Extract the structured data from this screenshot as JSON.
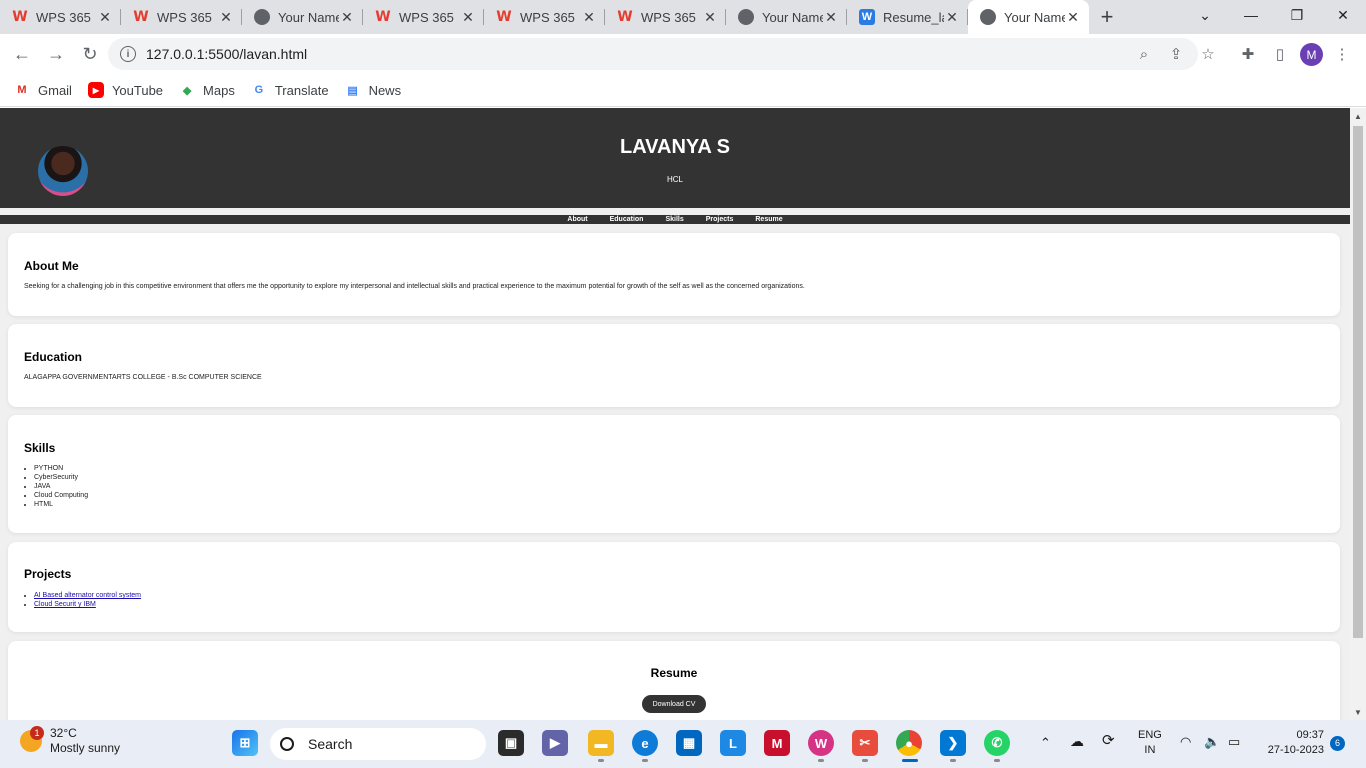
{
  "browser": {
    "tabs": [
      {
        "title": "WPS 365",
        "icon": "wps-icon"
      },
      {
        "title": "WPS 365",
        "icon": "wps-icon"
      },
      {
        "title": "Your Name",
        "icon": "globe-icon"
      },
      {
        "title": "WPS 365",
        "icon": "wps-icon"
      },
      {
        "title": "WPS 365",
        "icon": "wps-icon"
      },
      {
        "title": "WPS 365",
        "icon": "wps-icon"
      },
      {
        "title": "Your Name",
        "icon": "globe-icon"
      },
      {
        "title": "Resume_la",
        "icon": "wps-doc-icon"
      },
      {
        "title": "Your Name",
        "icon": "globe-icon",
        "active": true
      }
    ],
    "url": "127.0.0.1:5500/lavan.html",
    "profile_initial": "M",
    "bookmarks": [
      "Gmail",
      "YouTube",
      "Maps",
      "Translate",
      "News"
    ]
  },
  "site": {
    "name": "LAVANYA S",
    "subtitle": "HCL",
    "nav": [
      "About",
      "Education",
      "Skills",
      "Projects",
      "Resume"
    ],
    "about": {
      "heading": "About Me",
      "text": "Seeking for a challenging job in this competitive environment that offers me the opportunity to explore my interpersonal and intellectual skills and practical experience to the maximum potential for growth of the self as well as the concerned organizations."
    },
    "education": {
      "heading": "Education",
      "text": "ALAGAPPA GOVERNMENTARTS COLLEGE - B.Sc COMPUTER SCIENCE"
    },
    "skills": {
      "heading": "Skills",
      "items": [
        "PYTHON",
        "CyberSecurity",
        "JAVA",
        "Cloud Computing",
        "HTML"
      ]
    },
    "projects": {
      "heading": "Projects",
      "items": [
        "AI Based alternator control system",
        "Cloud Securit y IBM"
      ]
    },
    "resume": {
      "heading": "Resume",
      "button": "Download CV"
    }
  },
  "taskbar": {
    "weather_temp": "32°C",
    "weather_desc": "Mostly sunny",
    "weather_badge": "1",
    "search_label": "Search",
    "lang_top": "ENG",
    "lang_bottom": "IN",
    "time": "09:37",
    "date": "27-10-2023",
    "notif_count": "6"
  }
}
